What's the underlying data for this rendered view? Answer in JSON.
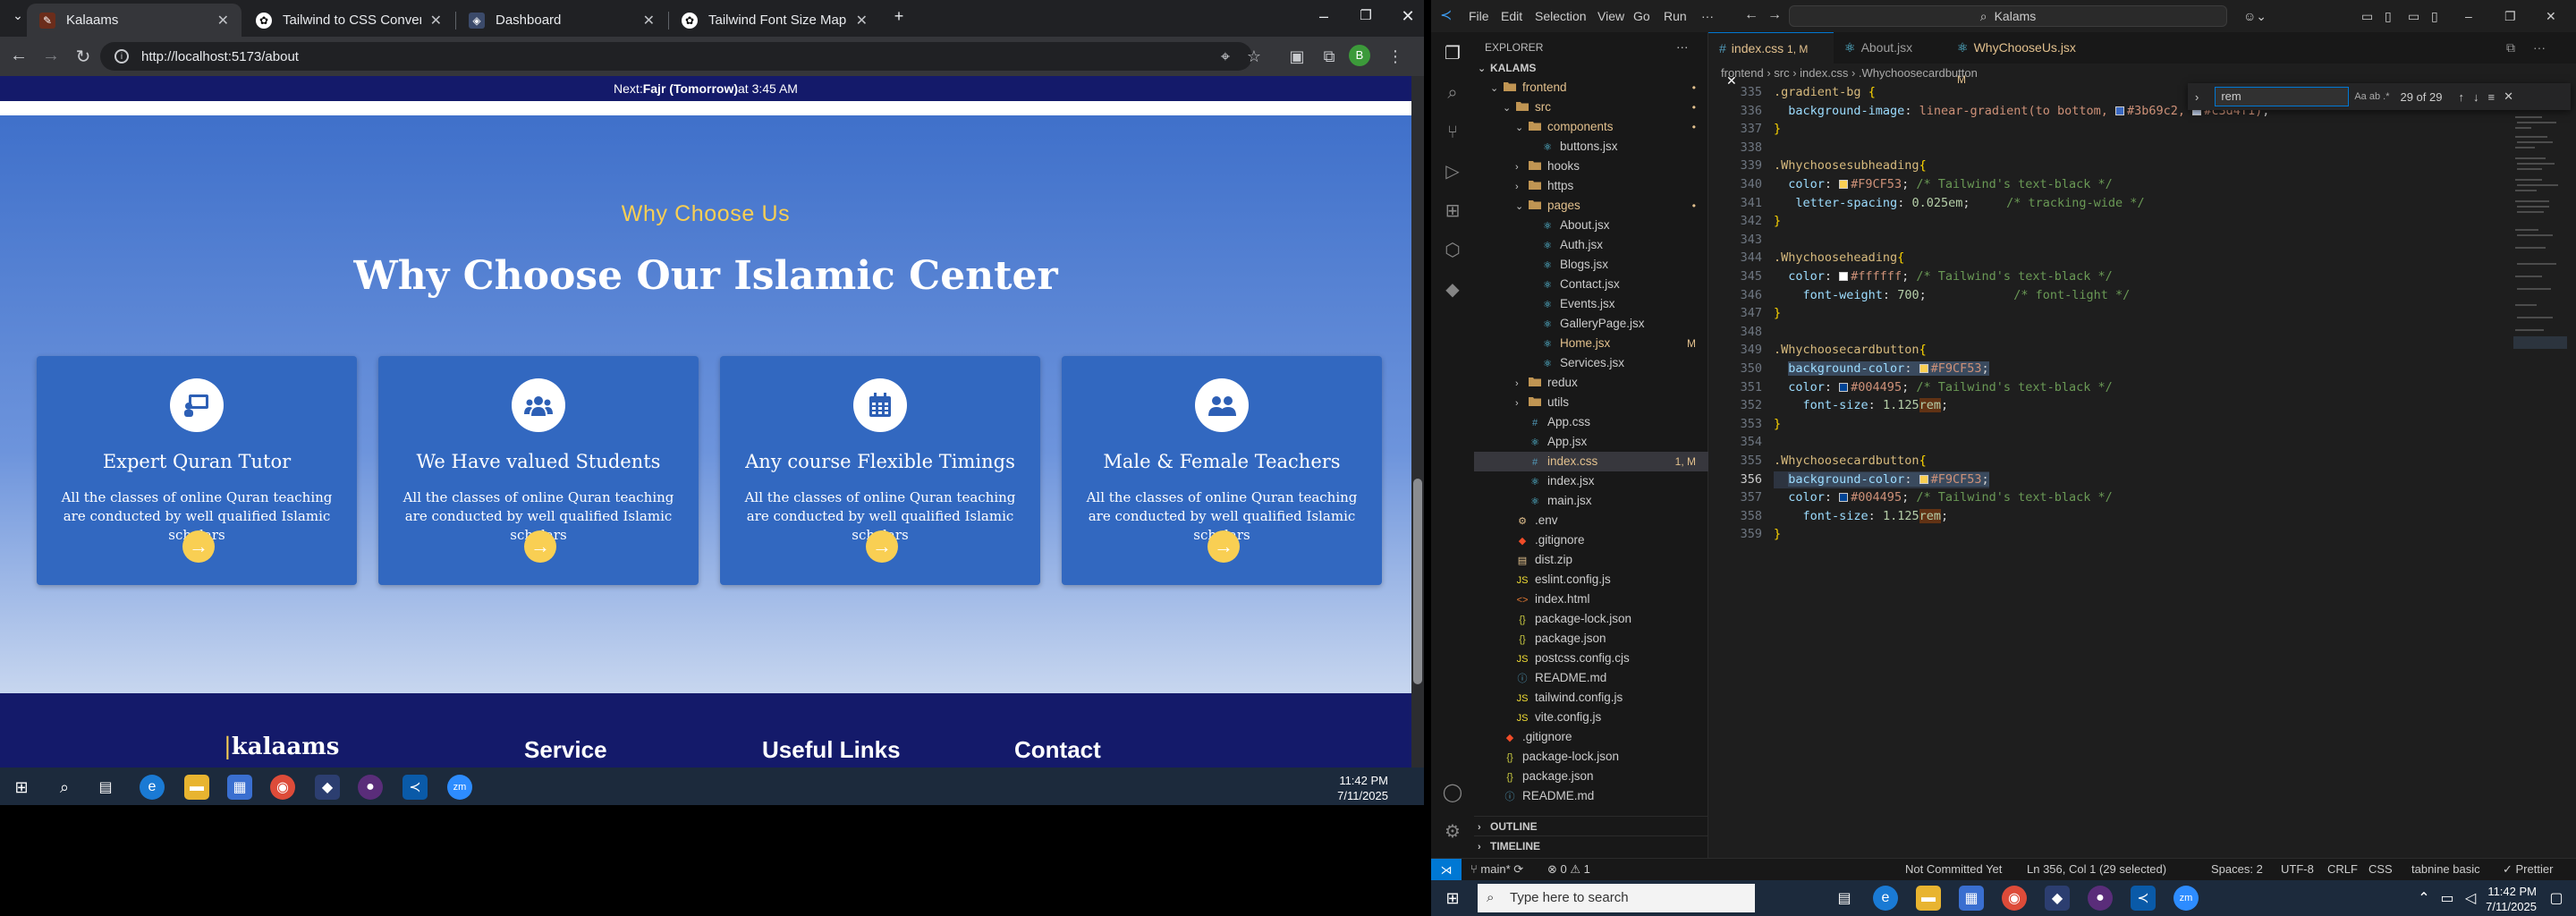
{
  "chrome": {
    "tabs": [
      {
        "label": "Kalaams",
        "active": true
      },
      {
        "label": "Tailwind to CSS Conversion",
        "active": false
      },
      {
        "label": "Dashboard",
        "active": false
      },
      {
        "label": "Tailwind Font Size Mapping",
        "active": false
      }
    ],
    "url": "http://localhost:5173/about"
  },
  "site": {
    "banner_prefix": "Next: ",
    "banner_bold": "Fajr (Tomorrow)",
    "banner_suffix": " at 3:45 AM",
    "subheading": "Why Choose Us",
    "heading": "Why Choose Our Islamic Center",
    "cards": [
      {
        "title": "Expert Quran Tutor",
        "desc": "All the classes of online Quran teaching are conducted by well qualified Islamic scholars",
        "icon": "teacher-board-icon"
      },
      {
        "title": "We Have valued Students",
        "desc": "All the classes of online Quran teaching are conducted by well qualified Islamic scholars",
        "icon": "users-group-icon"
      },
      {
        "title": "Any course Flexible Timings",
        "desc": "All the classes of online Quran teaching are conducted by well qualified Islamic scholars",
        "icon": "calendar-icon"
      },
      {
        "title": "Male & Female Teachers",
        "desc": "All the classes of online Quran teaching are conducted by well qualified Islamic scholars",
        "icon": "users-pair-icon"
      }
    ],
    "card_button": "→",
    "footer": {
      "logo_a": "|",
      "logo_b": "kalaams",
      "col1": "Service",
      "col2": "Useful Links",
      "col3": "Contact"
    }
  },
  "taskbar_left": {
    "time": "11:42 PM",
    "date": "7/11/2025"
  },
  "vscode": {
    "menus": [
      "File",
      "Edit",
      "Selection",
      "View",
      "Go",
      "Run",
      "···"
    ],
    "search": "Kalams",
    "explorer_title": "EXPLORER",
    "root": "KALAMS",
    "tree": [
      {
        "label": "frontend",
        "depth": 1,
        "type": "folder",
        "open": true,
        "badge": "•"
      },
      {
        "label": "src",
        "depth": 2,
        "type": "folder",
        "open": true,
        "badge": "•"
      },
      {
        "label": "components",
        "depth": 3,
        "type": "folder",
        "open": true,
        "badge": "•"
      },
      {
        "label": "buttons.jsx",
        "depth": 4,
        "type": "jsx"
      },
      {
        "label": "hooks",
        "depth": 3,
        "type": "folder",
        "open": false
      },
      {
        "label": "https",
        "depth": 3,
        "type": "folder",
        "open": false
      },
      {
        "label": "pages",
        "depth": 3,
        "type": "folder",
        "open": true,
        "badge": "•"
      },
      {
        "label": "About.jsx",
        "depth": 4,
        "type": "jsx"
      },
      {
        "label": "Auth.jsx",
        "depth": 4,
        "type": "jsx"
      },
      {
        "label": "Blogs.jsx",
        "depth": 4,
        "type": "jsx"
      },
      {
        "label": "Contact.jsx",
        "depth": 4,
        "type": "jsx"
      },
      {
        "label": "Events.jsx",
        "depth": 4,
        "type": "jsx"
      },
      {
        "label": "GalleryPage.jsx",
        "depth": 4,
        "type": "jsx"
      },
      {
        "label": "Home.jsx",
        "depth": 4,
        "type": "jsx",
        "badge": "M",
        "mod": true
      },
      {
        "label": "Services.jsx",
        "depth": 4,
        "type": "jsx"
      },
      {
        "label": "redux",
        "depth": 3,
        "type": "folder",
        "open": false
      },
      {
        "label": "utils",
        "depth": 3,
        "type": "folder",
        "open": false
      },
      {
        "label": "App.css",
        "depth": 3,
        "type": "css"
      },
      {
        "label": "App.jsx",
        "depth": 3,
        "type": "jsx"
      },
      {
        "label": "index.css",
        "depth": 3,
        "type": "css",
        "badge": "1, M",
        "sel": true,
        "mod": true
      },
      {
        "label": "index.jsx",
        "depth": 3,
        "type": "jsx"
      },
      {
        "label": "main.jsx",
        "depth": 3,
        "type": "jsx"
      },
      {
        "label": ".env",
        "depth": 2,
        "type": "env"
      },
      {
        "label": ".gitignore",
        "depth": 2,
        "type": "git"
      },
      {
        "label": "dist.zip",
        "depth": 2,
        "type": "zip"
      },
      {
        "label": "eslint.config.js",
        "depth": 2,
        "type": "js"
      },
      {
        "label": "index.html",
        "depth": 2,
        "type": "html"
      },
      {
        "label": "package-lock.json",
        "depth": 2,
        "type": "json"
      },
      {
        "label": "package.json",
        "depth": 2,
        "type": "json"
      },
      {
        "label": "postcss.config.cjs",
        "depth": 2,
        "type": "js"
      },
      {
        "label": "README.md",
        "depth": 2,
        "type": "md"
      },
      {
        "label": "tailwind.config.js",
        "depth": 2,
        "type": "js"
      },
      {
        "label": "vite.config.js",
        "depth": 2,
        "type": "js"
      },
      {
        "label": ".gitignore",
        "depth": 1,
        "type": "git"
      },
      {
        "label": "package-lock.json",
        "depth": 1,
        "type": "json"
      },
      {
        "label": "package.json",
        "depth": 1,
        "type": "json"
      },
      {
        "label": "README.md",
        "depth": 1,
        "type": "md"
      }
    ],
    "outline": "OUTLINE",
    "timeline": "TIMELINE",
    "tabs": [
      {
        "label": "index.css",
        "suffix": "1, M",
        "active": true
      },
      {
        "label": "About.jsx",
        "suffix": "",
        "active": false
      },
      {
        "label": "WhyChooseUs.jsx",
        "suffix": "M",
        "active": false
      }
    ],
    "breadcrumbs": "frontend  ›  src  ›  index.css  ›  .Whychoosecardbutton",
    "find": {
      "query": "rem",
      "count": "29 of 29",
      "opts": "Aa  ab  .*"
    },
    "code": [
      {
        "n": "335",
        "html": "<span class='c-sel'>.gradient-bg</span> <span class='c-br'>{</span>"
      },
      {
        "n": "336",
        "html": "  <span class='c-prop'>background-image</span>: <span class='c-val'>linear-gradient(to bottom, <span class='swatch' style='background:#3b69c2'></span>#3b69c2, <span class='swatch' style='background:#c3d4f1'></span>#c3d4f1)</span>;"
      },
      {
        "n": "337",
        "html": "<span class='c-br'>}</span>"
      },
      {
        "n": "338",
        "html": ""
      },
      {
        "n": "339",
        "html": "<span class='c-sel'>.Whychoosesubheading</span><span class='c-br'>{</span>"
      },
      {
        "n": "340",
        "html": "  <span class='c-prop'>color</span>: <span class='swatch' style='background:#F9CF53'></span><span class='c-val'>#F9CF53</span>; <span class='c-com'>/* Tailwind's text-black */</span>"
      },
      {
        "n": "341",
        "html": "   <span class='c-prop'>letter-spacing</span>: <span class='c-num'>0.025em</span>;     <span class='c-com'>/* tracking-wide */</span>"
      },
      {
        "n": "342",
        "html": "<span class='c-br'>}</span>"
      },
      {
        "n": "343",
        "html": ""
      },
      {
        "n": "344",
        "html": "<span class='c-sel'>.Whychooseheading</span><span class='c-br'>{</span>"
      },
      {
        "n": "345",
        "html": "  <span class='c-prop'>color</span>: <span class='swatch' style='background:#ffffff'></span><span class='c-val'>#ffffff</span>; <span class='c-com'>/* Tailwind's text-black */</span>"
      },
      {
        "n": "346",
        "html": "    <span class='c-prop'>font-weight</span>: <span class='c-num'>700</span>;            <span class='c-com'>/* font-light */</span>"
      },
      {
        "n": "347",
        "html": "<span class='c-br'>}</span>"
      },
      {
        "n": "348",
        "html": ""
      },
      {
        "n": "349",
        "html": "<span class='c-sel'>.Whychoosecardbutton</span><span class='c-br'>{</span>"
      },
      {
        "n": "350",
        "html": "  <span class='sel-text'><span class='c-prop'>background-color</span>: <span class='swatch' style='background:#F9CF53'></span><span class='c-val'>#F9CF53</span>;</span>"
      },
      {
        "n": "351",
        "html": "  <span class='c-prop'>color</span>: <span class='swatch' style='background:#004495'></span><span class='c-val'>#004495</span>; <span class='c-com'>/* Tailwind's text-black */</span>"
      },
      {
        "n": "352",
        "html": "    <span class='c-prop'>font-size</span>: <span class='c-num'>1.125</span><span class='c-unit'>rem</span>;"
      },
      {
        "n": "353",
        "html": "<span class='c-br'>}</span>"
      },
      {
        "n": "354",
        "html": ""
      },
      {
        "n": "355",
        "html": "<span class='c-sel'>.Whychoosecardbutton</span><span class='c-br'>{</span>"
      },
      {
        "n": "356",
        "html": "  <span class='sel-text'><span class='c-prop'>background-color</span>: <span class='swatch' style='background:#F9CF53'></span><span class='c-val'>#F9CF53</span>;</span>"
      },
      {
        "n": "357",
        "html": "  <span class='c-prop'>color</span>: <span class='swatch' style='background:#004495'></span><span class='c-val'>#004495</span>; <span class='c-com'>/* Tailwind's text-black */</span>"
      },
      {
        "n": "358",
        "html": "    <span class='c-prop'>font-size</span>: <span class='c-num'>1.125</span><span class='c-unit'>rem</span>;"
      },
      {
        "n": "359",
        "html": "<span class='c-br'>}</span>"
      }
    ],
    "status": {
      "branch": "main*",
      "problems": "⊗ 0 ⚠ 1",
      "commit": "Not Committed Yet",
      "position": "Ln 356, Col 1 (29 selected)",
      "spaces": "Spaces: 2",
      "encoding": "UTF-8",
      "eol": "CRLF",
      "lang": "CSS",
      "tabnine": "tabnine basic",
      "prettier": "✓ Prettier"
    }
  },
  "taskbar_right": {
    "search_placeholder": "Type here to search",
    "time": "11:42 PM",
    "date": "7/11/2025"
  },
  "colors": {
    "gold": "#F9CF53",
    "navy": "#141a6a",
    "card": "#3268c0",
    "vs_accent": "#0078d4"
  }
}
